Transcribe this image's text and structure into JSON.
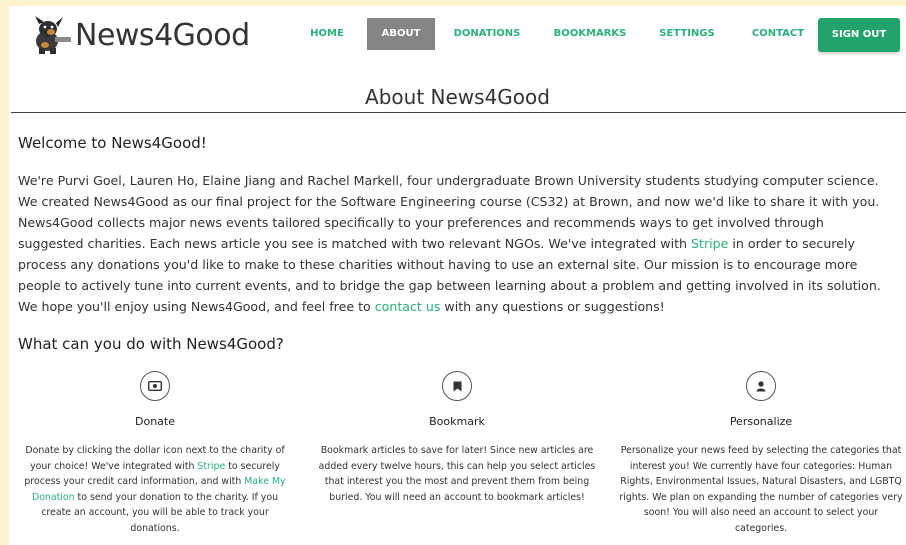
{
  "brand": {
    "name": "News4Good"
  },
  "nav": {
    "items": [
      {
        "label": "HOME",
        "active": false
      },
      {
        "label": "ABOUT",
        "active": true
      },
      {
        "label": "DONATIONS",
        "active": false
      },
      {
        "label": "BOOKMARKS",
        "active": false
      },
      {
        "label": "SETTINGS",
        "active": false
      },
      {
        "label": "CONTACT",
        "active": false
      }
    ],
    "sign_out": "SIGN OUT"
  },
  "colors": {
    "accent": "#2bb07a",
    "sign_out_bg": "#22a36c",
    "active_tab": "#858585"
  },
  "page_title": "About News4Good",
  "welcome": {
    "heading": "Welcome to News4Good!",
    "p1": "We're Purvi Goel, Lauren Ho, Elaine Jiang and Rachel Markell, four undergraduate Brown University students studying computer science. We created News4Good as our final project for the Software Engineering course (CS32) at Brown, and now we'd like to share it with you. News4Good collects major news events tailored specifically to your preferences and recommends ways to get involved through suggested charities. Each news article you see is matched with two relevant NGOs. We've integrated with ",
    "stripe_link": "Stripe",
    "p2": " in order to securely process any donations you'd like to make to these charities without having to use an external site. Our mission is to encourage more people to actively tune into current events, and to bridge the gap between learning about a problem and getting involved in its solution. We hope you'll enjoy using News4Good, and feel free to ",
    "contact_link": "contact us",
    "p3": " with any questions or suggestions!"
  },
  "what": {
    "heading": "What can you do with News4Good?",
    "features": [
      {
        "icon": "dollar-icon",
        "title": "Donate",
        "t1": "Donate by clicking the dollar icon next to the charity of your choice! We've integrated with ",
        "link1": "Stripe",
        "t2": " to securely process your credit card information, and with ",
        "link2": "Make My Donation",
        "t3": " to send your donation to the charity. If you create an account, you will be able to track your donations."
      },
      {
        "icon": "bookmark-icon",
        "title": "Bookmark",
        "text": "Bookmark articles to save for later! Since new articles are added every twelve hours, this can help you select articles that interest you the most and prevent them from being buried. You will need an account to bookmark articles!"
      },
      {
        "icon": "user-icon",
        "title": "Personalize",
        "text": "Personalize your news feed by selecting the categories that interest you! We currently have four categories: Human Rights, Environmental Issues, Natural Disasters, and LGBTQ rights. We plan on expanding the number of categories very soon! You will also need an account to select your categories."
      }
    ]
  }
}
